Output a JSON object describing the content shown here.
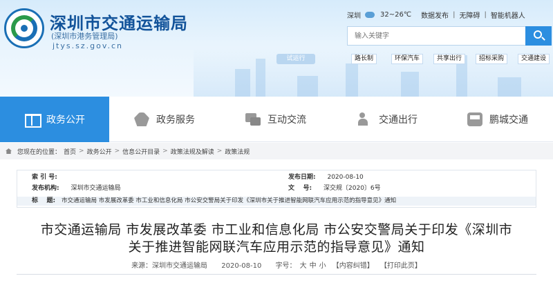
{
  "header": {
    "title": "深圳市交通运输局",
    "subtitle": "(深圳市港务管理局)",
    "url": "jtys.sz.gov.cn",
    "city": "深圳",
    "weather": "32~26℃",
    "links": [
      "数据发布",
      "无障碍",
      "智能机器人"
    ],
    "search_placeholder": "输入关键字",
    "trial_badge": "试运行",
    "quick_links": [
      "路长制",
      "环保汽车",
      "共享出行",
      "招标采购",
      "交通建设"
    ]
  },
  "nav": [
    {
      "label": "政务公开",
      "icon": "book-icon"
    },
    {
      "label": "政务服务",
      "icon": "handshake-icon"
    },
    {
      "label": "互动交流",
      "icon": "chat-icon"
    },
    {
      "label": "交通出行",
      "icon": "person-icon"
    },
    {
      "label": "鹏城交通",
      "icon": "bus-icon"
    }
  ],
  "breadcrumb": {
    "prefix": "您现在的位置：",
    "items": [
      "首页",
      "政务公开",
      "信息公开目录",
      "政策法规及解读",
      "政策法规"
    ]
  },
  "meta": {
    "index_label": "索 引 号:",
    "index_value": "",
    "org_label": "发布机构:",
    "org_value": "深圳市交通运输局",
    "date_label": "发布日期:",
    "date_value": "2020-08-10",
    "doc_label": "文    号:",
    "doc_value": "深交规〔2020〕6号",
    "title_label": "标    题:",
    "title_value": "市交通运输局 市发展改革委 市工业和信息化局 市公安交警局关于印发《深圳市关于推进智能网联汽车应用示范的指导意见》通知"
  },
  "article": {
    "title_line1": "市交通运输局 市发展改革委 市工业和信息化局 市公安交警局关于印发《深圳市",
    "title_line2": "关于推进智能网联汽车应用示范的指导意见》通知",
    "source_label": "来源：深圳市交通运输局",
    "date": "2020-08-10",
    "font_label": "字号：",
    "font_large": "大",
    "font_medium": "中",
    "font_small": "小",
    "error_link": "【内容纠错】",
    "print_link": "【打印此页】"
  },
  "colors": {
    "accent": "#2c8ee0",
    "title_blue": "#12539a"
  }
}
